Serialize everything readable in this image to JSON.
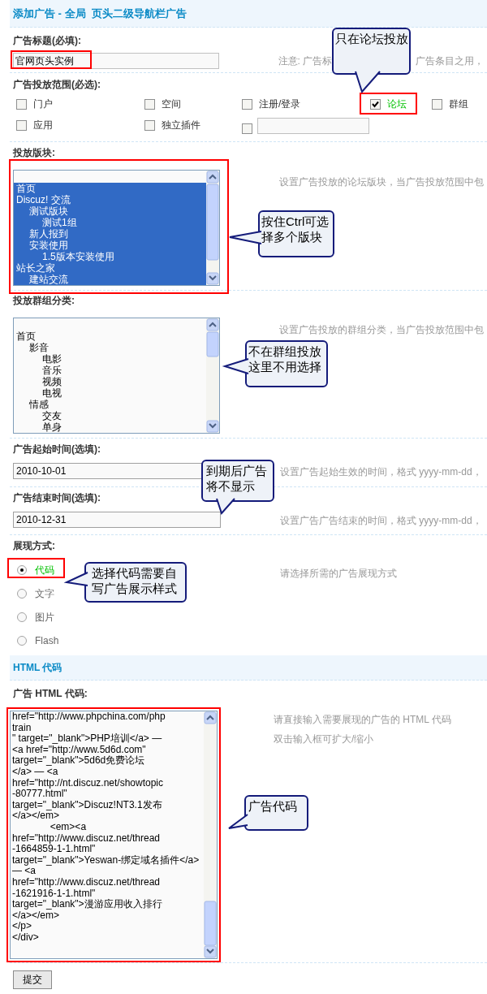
{
  "header": {
    "title": "添加广告 - 全局  页头二级导航栏广告"
  },
  "title_field": {
    "label": "广告标题(必填):",
    "value": "官网页头实例",
    "hint_parts": [
      "注意: 广告标",
      "广告条目之用，"
    ]
  },
  "scope": {
    "label": "广告投放范围(必选):",
    "options": [
      {
        "kind": "label",
        "label": "门户",
        "checked": false
      },
      {
        "kind": "label",
        "label": "空间",
        "checked": false
      },
      {
        "kind": "label",
        "label": "注册/登录",
        "checked": false
      },
      {
        "kind": "label",
        "label": "论坛",
        "checked": true
      },
      {
        "kind": "label",
        "label": "群组",
        "checked": false
      },
      {
        "kind": "label",
        "label": "应用",
        "checked": false
      },
      {
        "kind": "label",
        "label": "独立插件",
        "checked": false
      },
      {
        "kind": "input",
        "checked": false
      }
    ]
  },
  "forums": {
    "label": "投放版块:",
    "hint": "设置广告投放的论坛版块，当广告投放范围中包",
    "items": [
      {
        "selected": false
      },
      {
        "label": "首页",
        "selected": true
      },
      {
        "label": "Discuz! 交流",
        "selected": true,
        "children": [
          {
            "label": "测试版块",
            "selected": true,
            "children": [
              {
                "label": "测试1组",
                "selected": true
              }
            ]
          },
          {
            "label": "新人报到",
            "selected": true
          },
          {
            "label": "安装使用",
            "selected": true,
            "children": [
              {
                "label": "1.5版本安装使用",
                "selected": true
              }
            ]
          }
        ]
      },
      {
        "label": "站长之家",
        "selected": true,
        "children": [
          {
            "label": "建站交流",
            "selected": true
          }
        ]
      }
    ]
  },
  "groups": {
    "label": "投放群组分类:",
    "hint": "设置广告投放的群组分类，当广告投放范围中包",
    "items": [
      {
        "selected": false
      },
      {
        "label": "首页",
        "selected": false,
        "children": [
          {
            "label": "影音",
            "selected": false,
            "children": [
              {
                "label": "电影",
                "selected": false
              },
              {
                "label": "音乐",
                "selected": false
              },
              {
                "label": "视频",
                "selected": false
              },
              {
                "label": "电视",
                "selected": false
              }
            ]
          },
          {
            "label": "情感",
            "selected": false,
            "children": [
              {
                "label": "交友",
                "selected": false
              },
              {
                "label": "单身",
                "selected": false
              }
            ]
          }
        ]
      }
    ]
  },
  "start_time": {
    "label": "广告起始时间(选填):",
    "value": "2010-10-01",
    "hint": "设置广告起始生效的时间，格式 yyyy-mm-dd，"
  },
  "end_time": {
    "label": "广告结束时间(选填):",
    "value": "2010-12-31",
    "hint": "设置广告广告结束的时间，格式 yyyy-mm-dd，"
  },
  "display": {
    "label": "展现方式:",
    "hint": "请选择所需的广告展现方式",
    "options": [
      {
        "label": "代码",
        "selected": true
      },
      {
        "label": "文字",
        "selected": false
      },
      {
        "label": "图片",
        "selected": false
      },
      {
        "label": "Flash",
        "selected": false
      }
    ]
  },
  "html_section": {
    "title": "HTML 代码"
  },
  "html_code": {
    "label": "广告  HTML 代码:",
    "value": "href=\"http://www.phpchina.com/php\ntrain\n\" target=\"_blank\">PHP培训</a> —\n<a href=\"http://www.5d6d.com\"\ntarget=\"_blank\">5d6d免费论坛\n</a> — <a\nhref=\"http://nt.discuz.net/showtopic\n-80777.html\"\ntarget=\"_blank\">Discuz!NT3.1发布\n</a></em>\n              <em><a\nhref=\"http://www.discuz.net/thread\n-1664859-1-1.html\"\ntarget=\"_blank\">Yeswan-绑定域名插件</a> — <a\nhref=\"http://www.discuz.net/thread\n-1621916-1-1.html\"\ntarget=\"_blank\">漫游应用收入排行\n</a></em>\n</p>\n</div>",
    "hints": [
      "请直接输入需要展现的广告的 HTML 代码",
      "双击输入框可扩大/缩小"
    ]
  },
  "submit": {
    "label": "提交"
  },
  "callouts": [
    "只在论坛投放",
    "按住Ctrl可选择多个版块",
    "不在群组投放这里不用选择",
    "到期后广告将不显示",
    "选择代码需要自写广告展示样式",
    "广告代码"
  ]
}
